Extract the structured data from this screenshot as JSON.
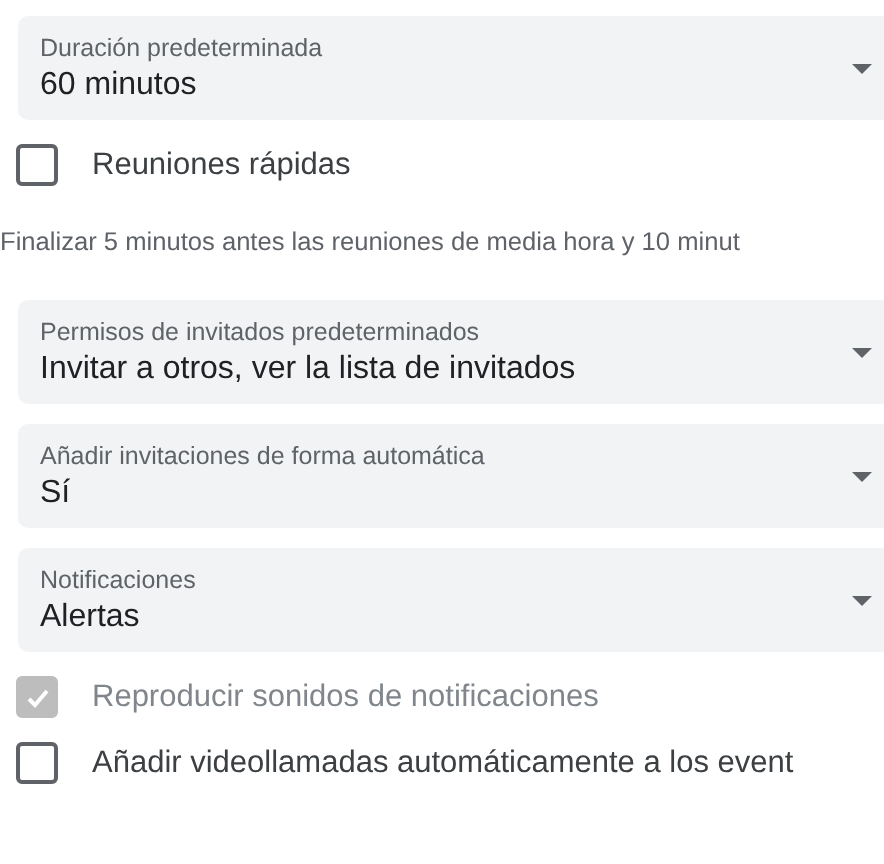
{
  "settings": [
    {
      "kind": "dropdown",
      "label": "Duración predeterminada",
      "value": "60 minutos"
    },
    {
      "kind": "checkbox",
      "label": "Reuniones rápidas",
      "checked": false,
      "disabled": false
    },
    {
      "kind": "hint",
      "text": "Finalizar 5 minutos antes las reuniones de media hora y 10 minut"
    },
    {
      "kind": "dropdown",
      "label": "Permisos de invitados predeterminados",
      "value": "Invitar a otros, ver la lista de invitados"
    },
    {
      "kind": "dropdown",
      "label": "Añadir invitaciones de forma automática",
      "value": "Sí"
    },
    {
      "kind": "dropdown",
      "label": "Notificaciones",
      "value": "Alertas"
    },
    {
      "kind": "checkbox",
      "label": "Reproducir sonidos de notificaciones",
      "checked": true,
      "disabled": true
    },
    {
      "kind": "checkbox",
      "label": "Añadir videollamadas automáticamente a los event",
      "checked": false,
      "disabled": false
    }
  ]
}
